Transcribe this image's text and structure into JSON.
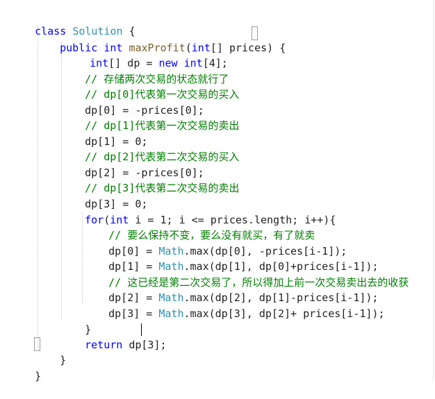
{
  "editor": {
    "lines": [
      "class Solution {",
      "public int maxProfit(int[] prices) {",
      "int[] dp = new int[4];",
      "// 存储两次交易的状态就行了",
      "// dp[0]代表第一次交易的买入",
      "dp[0] = -prices[0];",
      "// dp[1]代表第一次交易的卖出",
      "dp[1] = 0;",
      "// dp[2]代表第二次交易的买入",
      "dp[2] = -prices[0];",
      "// dp[3]代表第二次交易的卖出",
      "dp[3] = 0;",
      "for(int i = 1; i <= prices.length; i++){",
      "// 要么保持不变，要么没有就买，有了就卖",
      "dp[0] = Math.max(dp[0], -prices[i-1]);",
      "dp[1] = Math.max(dp[1], dp[0]+prices[i-1]);",
      "// 这已经是第二次交易了，所以得加上前一次交易卖出去的收获",
      "dp[2] = Math.max(dp[2], dp[1]-prices[i-1]);",
      "dp[3] = Math.max(dp[3], dp[2]+ prices[i-1]);",
      "}",
      "return dp[3];",
      "}",
      "}"
    ]
  },
  "colors": {
    "keyword": "#0000ff",
    "type": "#2b91af",
    "comment": "#008000",
    "text": "#1f1f1f"
  }
}
